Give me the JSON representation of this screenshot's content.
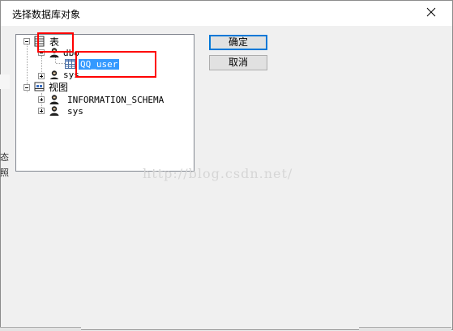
{
  "window": {
    "title": "选择数据库对象"
  },
  "tree": {
    "tables_label": "表",
    "tables_schema_dbo": "dbo",
    "tables_dbo_item": "QQ_user",
    "tables_schema_sys": "sys",
    "views_label": "视图",
    "views_schema_info": "INFORMATION_SCHEMA",
    "views_schema_sys": "sys"
  },
  "buttons": {
    "ok": "确定",
    "cancel": "取消"
  },
  "watermark": "http://blog.csdn.net/",
  "background_fragments": [
    "态",
    "照"
  ],
  "colors": {
    "selection": "#3399ff",
    "highlight_box": "#ff0000",
    "default_button_border": "#0078d7"
  }
}
